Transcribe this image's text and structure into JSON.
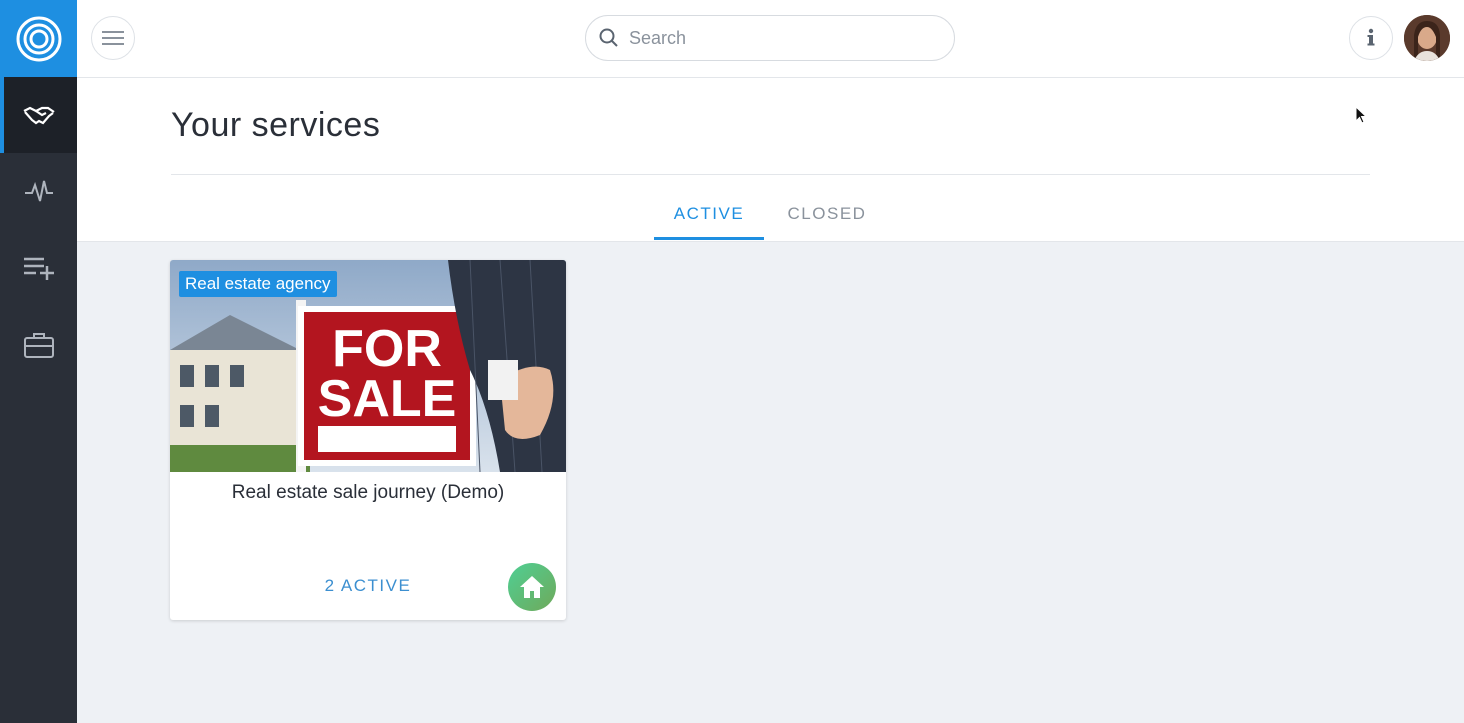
{
  "search": {
    "placeholder": "Search"
  },
  "page": {
    "title": "Your services"
  },
  "tabs": [
    {
      "label": "ACTIVE",
      "active": true
    },
    {
      "label": "CLOSED",
      "active": false
    }
  ],
  "sidebar": {
    "items": [
      {
        "icon": "handshake-icon",
        "active": true
      },
      {
        "icon": "activity-icon",
        "active": false
      },
      {
        "icon": "playlist-add-icon",
        "active": false
      },
      {
        "icon": "briefcase-icon",
        "active": false
      }
    ]
  },
  "cards": [
    {
      "badge": "Real estate agency",
      "title": "Real estate sale journey (Demo)",
      "status": "2 ACTIVE",
      "image_text": [
        "FOR",
        "SALE"
      ],
      "icon": "home-icon"
    }
  ],
  "colors": {
    "accent": "#1e8fe1",
    "sidebar": "#2a2f38",
    "background": "#eef1f5"
  }
}
